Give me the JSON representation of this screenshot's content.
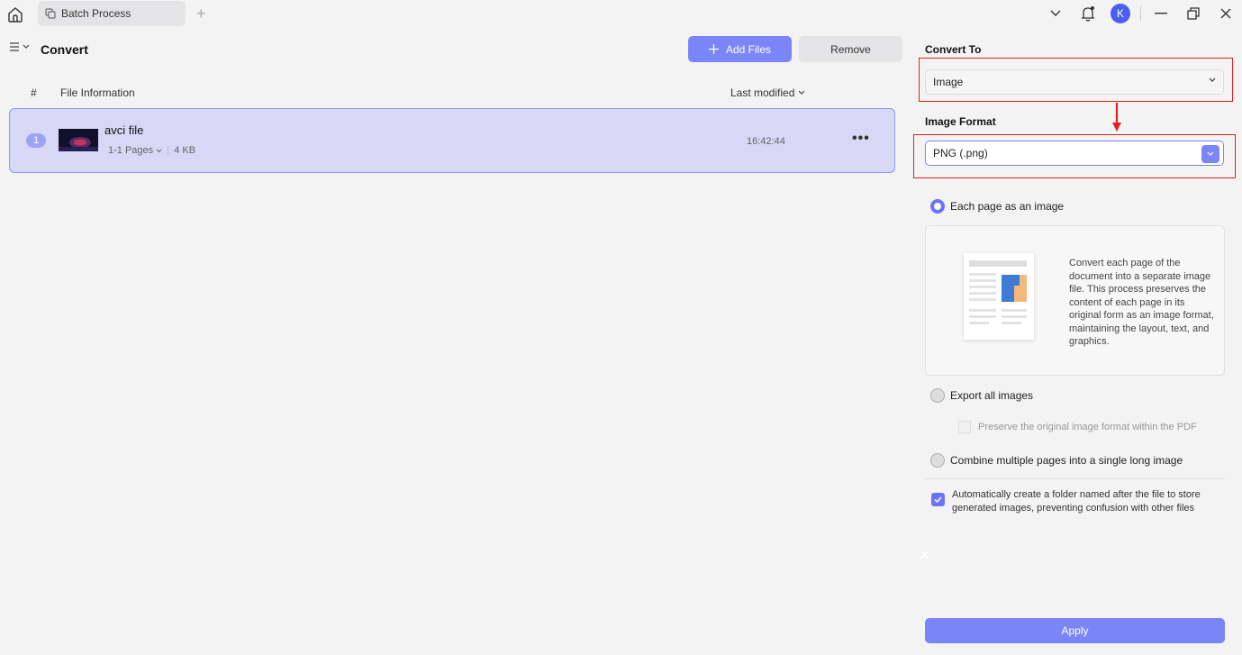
{
  "titlebar": {
    "tab_label": "Batch Process",
    "avatar_initial": "K"
  },
  "main": {
    "title": "Convert",
    "add_files_label": "Add Files",
    "remove_label": "Remove",
    "columns": {
      "hash": "#",
      "file_info": "File Information",
      "last_modified": "Last modified"
    },
    "files": [
      {
        "index": "1",
        "name": "avci file",
        "pages": "1-1 Pages",
        "size": "4 KB",
        "time": "16:42:44",
        "more": "•••"
      }
    ]
  },
  "side": {
    "convert_to_label": "Convert To",
    "convert_to_value": "Image",
    "image_format_label": "Image Format",
    "image_format_value": "PNG (.png)",
    "option_each_page": "Each page as an image",
    "info_text": "Convert each page of the document into a separate image file. This process preserves the content of each page in its original form as an image format, maintaining the layout, text, and graphics.",
    "option_export_all": "Export all images",
    "preserve_format": "Preserve the original image format within the PDF",
    "option_combine": "Combine multiple pages into a single long image",
    "auto_folder": "Automatically create a folder named after the file to store generated images, preventing confusion with other files",
    "apply_label": "Apply"
  },
  "colors": {
    "accent": "#7c85f7",
    "selected_row": "#d6d8f5",
    "highlight_box": "#e02020",
    "avatar": "#4a5ef0"
  }
}
